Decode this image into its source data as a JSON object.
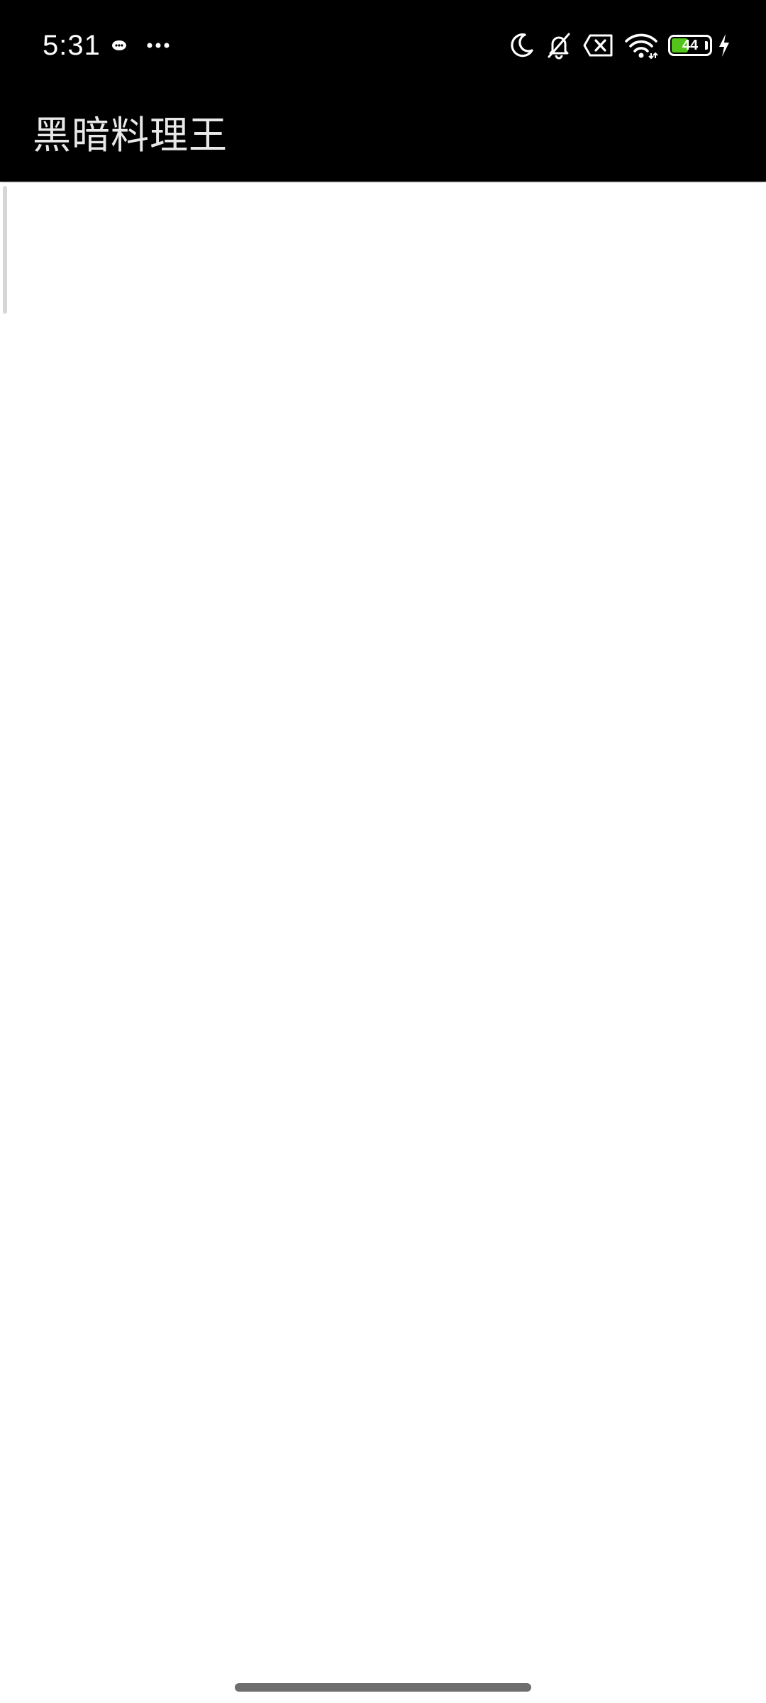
{
  "status_bar": {
    "time": "5:31",
    "left_icons": [
      "messaging-app-icon",
      "more-dots-icon"
    ],
    "right_icons": [
      "moon-icon",
      "bell-off-icon",
      "no-sim-icon",
      "wifi-icon",
      "battery-icon",
      "charging-bolt-icon"
    ],
    "battery_level": "44",
    "battery_fraction": 0.44,
    "battery_color": "#52c41a"
  },
  "app_bar": {
    "title": "黑暗料理王",
    "background": "#000000"
  },
  "content": {
    "background": "#ffffff"
  }
}
